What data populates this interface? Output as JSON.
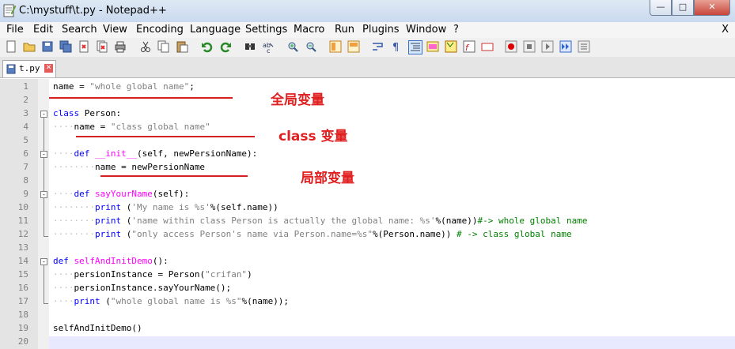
{
  "window": {
    "title": "C:\\mystuff\\t.py - Notepad++"
  },
  "menu": [
    "File",
    "Edit",
    "Search",
    "View",
    "Encoding",
    "Language",
    "Settings",
    "Macro",
    "Run",
    "Plugins",
    "Window",
    "?"
  ],
  "menu_close": "X",
  "toolbar": {
    "icons": [
      "new-file-icon",
      "open-file-icon",
      "save-icon",
      "save-all-icon",
      "close-icon",
      "close-all-icon",
      "print-icon",
      "cut-icon",
      "copy-icon",
      "paste-icon",
      "undo-icon",
      "redo-icon",
      "find-icon",
      "replace-icon",
      "zoom-in-icon",
      "zoom-out-icon",
      "sync-v-icon",
      "sync-h-icon",
      "wrap-icon",
      "show-all-chars-icon",
      "indent-guide-icon",
      "user-lang-icon",
      "doc-map-icon",
      "function-list-icon",
      "folder-workspace-icon",
      "record-macro-icon",
      "stop-macro-icon",
      "play-macro-icon",
      "run-macro-multiple-icon",
      "save-macro-icon"
    ]
  },
  "tab": {
    "label": "t.py"
  },
  "lines": [
    {
      "n": "1",
      "code": "name = \"whole global name\";"
    },
    {
      "n": "2",
      "code": ""
    },
    {
      "n": "3",
      "code": "class Person:"
    },
    {
      "n": "4",
      "code": "    name = \"class global name\""
    },
    {
      "n": "5",
      "code": ""
    },
    {
      "n": "6",
      "code": "    def __init__(self, newPersionName):"
    },
    {
      "n": "7",
      "code": "        name = newPersionName"
    },
    {
      "n": "8",
      "code": ""
    },
    {
      "n": "9",
      "code": "    def sayYourName(self):"
    },
    {
      "n": "10",
      "code": "        print ('My name is %s'%(self.name))"
    },
    {
      "n": "11",
      "code": "        print ('name within class Person is actually the global name: %s'%(name))#-> whole global name"
    },
    {
      "n": "12",
      "code": "        print (\"only access Person's name via Person.name=%s\"%(Person.name)) # -> class global name"
    },
    {
      "n": "13",
      "code": ""
    },
    {
      "n": "14",
      "code": "def selfAndInitDemo():"
    },
    {
      "n": "15",
      "code": "    persionInstance = Person(\"crifan\")"
    },
    {
      "n": "16",
      "code": "    persionInstance.sayYourName();"
    },
    {
      "n": "17",
      "code": "    print (\"whole global name is %s\"%(name));"
    },
    {
      "n": "18",
      "code": ""
    },
    {
      "n": "19",
      "code": "selfAndInitDemo()"
    },
    {
      "n": "20",
      "code": ""
    }
  ],
  "annotations": {
    "global": "全局变量",
    "class": "class 变量",
    "local": "局部变量"
  },
  "colors": {
    "annotation": "#e02020",
    "keyword": "#0000ff",
    "function": "#ff00ff",
    "string": "#808080",
    "comment": "#008000"
  }
}
